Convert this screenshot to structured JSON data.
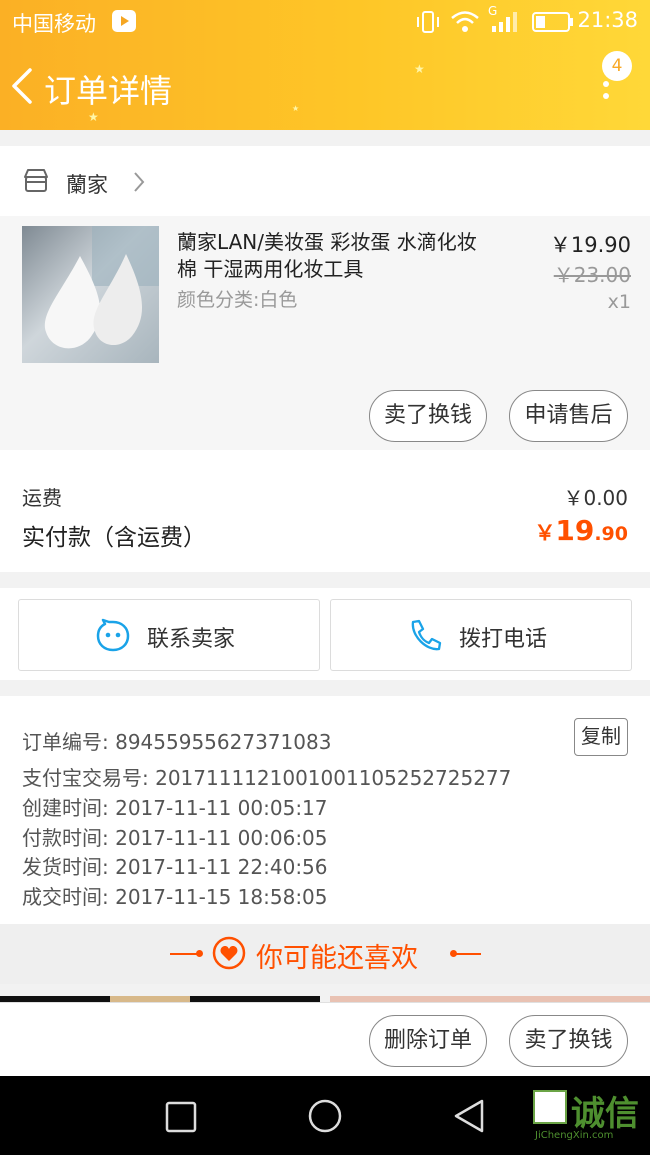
{
  "status_bar": {
    "carrier": "中国移动",
    "network": "G",
    "time": "21:38"
  },
  "header": {
    "title": "订单详情",
    "badge_count": "4"
  },
  "shop": {
    "name": "蘭家"
  },
  "product": {
    "title": "蘭家LAN/美妆蛋 彩妆蛋 水滴化妆棉 干湿两用化妆工具",
    "title_line1": "蘭家LAN/美妆蛋 彩妆蛋 水滴化妆",
    "title_line2": "棉 干湿两用化妆工具",
    "variant": "颜色分类:白色",
    "price": "￥19.90",
    "original_price": "￥23.00",
    "quantity": "x1",
    "sell_exchange_label": "卖了换钱",
    "after_sale_label": "申请售后"
  },
  "payment": {
    "shipping_label": "运费",
    "shipping_value": "￥0.00",
    "total_label": "实付款（含运费）",
    "total_currency": "￥",
    "total_integer": "19",
    "total_decimal": ".90"
  },
  "contact": {
    "contact_seller_label": "联系卖家",
    "call_label": "拨打电话"
  },
  "order_info": {
    "order_no": "订单编号: 89455955627371083",
    "copy_label": "复制",
    "alipay_no": "支付宝交易号: 2017111121001001105252725277",
    "created": "创建时间: 2017-11-11 00:05:17",
    "paid": "付款时间: 2017-11-11 00:06:05",
    "shipped": "发货时间: 2017-11-11 22:40:56",
    "completed": "成交时间: 2017-11-15 18:58:05"
  },
  "recommend": {
    "title": "你可能还喜欢"
  },
  "bottom_actions": {
    "delete_label": "删除订单",
    "sell_exchange_label": "卖了换钱"
  },
  "watermark": {
    "text": "诚信",
    "sub": "JiChengXin.com"
  },
  "colors": {
    "header_start": "#fbb025",
    "header_end": "#ffd838",
    "accent_orange": "#ff5000",
    "icon_blue": "#1aa3e8"
  }
}
